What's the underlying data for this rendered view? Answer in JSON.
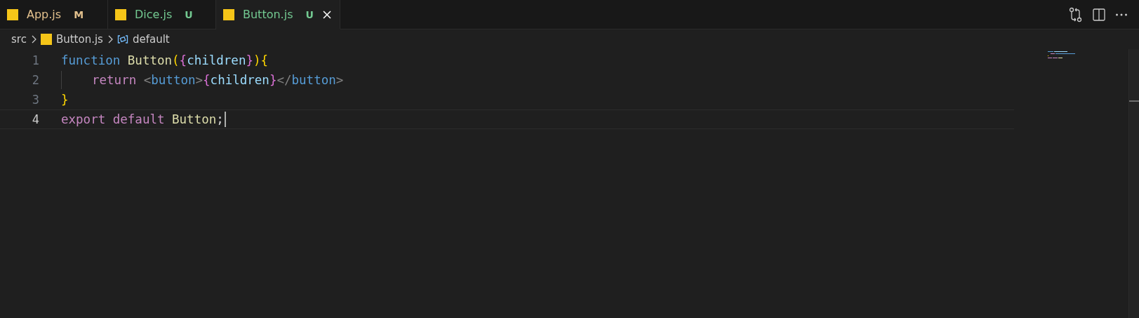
{
  "tabs": [
    {
      "label": "App.js",
      "badge": "M",
      "color": "#e2c08d",
      "selected": false,
      "closable": false
    },
    {
      "label": "Dice.js",
      "badge": "U",
      "color": "#73c991",
      "selected": false,
      "closable": false
    },
    {
      "label": "Button.js",
      "badge": "U",
      "color": "#73c991",
      "selected": true,
      "closable": true
    }
  ],
  "breadcrumbs": [
    {
      "label": "src",
      "kind": "folder"
    },
    {
      "label": "Button.js",
      "kind": "file"
    },
    {
      "label": "default",
      "kind": "symbol"
    }
  ],
  "lines": [
    {
      "number": "1",
      "current": false,
      "indented": false,
      "tokens": [
        {
          "text": "function",
          "kind": "keyword"
        },
        {
          "text": " Button",
          "kind": "func"
        },
        {
          "text": "(",
          "kind": "bracket1"
        },
        {
          "text": "{",
          "kind": "bracket2"
        },
        {
          "text": "children",
          "kind": "param"
        },
        {
          "text": "}",
          "kind": "bracket2"
        },
        {
          "text": ")",
          "kind": "bracket1"
        },
        {
          "text": "{",
          "kind": "bracket1"
        }
      ]
    },
    {
      "number": "2",
      "current": false,
      "indented": true,
      "tokens": [
        {
          "text": "return",
          "kind": "control"
        },
        {
          "text": " <",
          "kind": "punct"
        },
        {
          "text": "button",
          "kind": "tag"
        },
        {
          "text": ">",
          "kind": "punct"
        },
        {
          "text": "{",
          "kind": "bracket2"
        },
        {
          "text": "children",
          "kind": "param"
        },
        {
          "text": "}",
          "kind": "bracket2"
        },
        {
          "text": "</",
          "kind": "punct"
        },
        {
          "text": "button",
          "kind": "tag"
        },
        {
          "text": ">",
          "kind": "punct"
        }
      ]
    },
    {
      "number": "3",
      "current": false,
      "indented": false,
      "tokens": [
        {
          "text": "}",
          "kind": "bracket1"
        }
      ]
    },
    {
      "number": "4",
      "current": true,
      "indented": false,
      "tokens": [
        {
          "text": "export",
          "kind": "control"
        },
        {
          "text": " default",
          "kind": "control"
        },
        {
          "text": " Button",
          "kind": "func"
        },
        {
          "text": ";",
          "kind": "plain"
        }
      ]
    }
  ]
}
